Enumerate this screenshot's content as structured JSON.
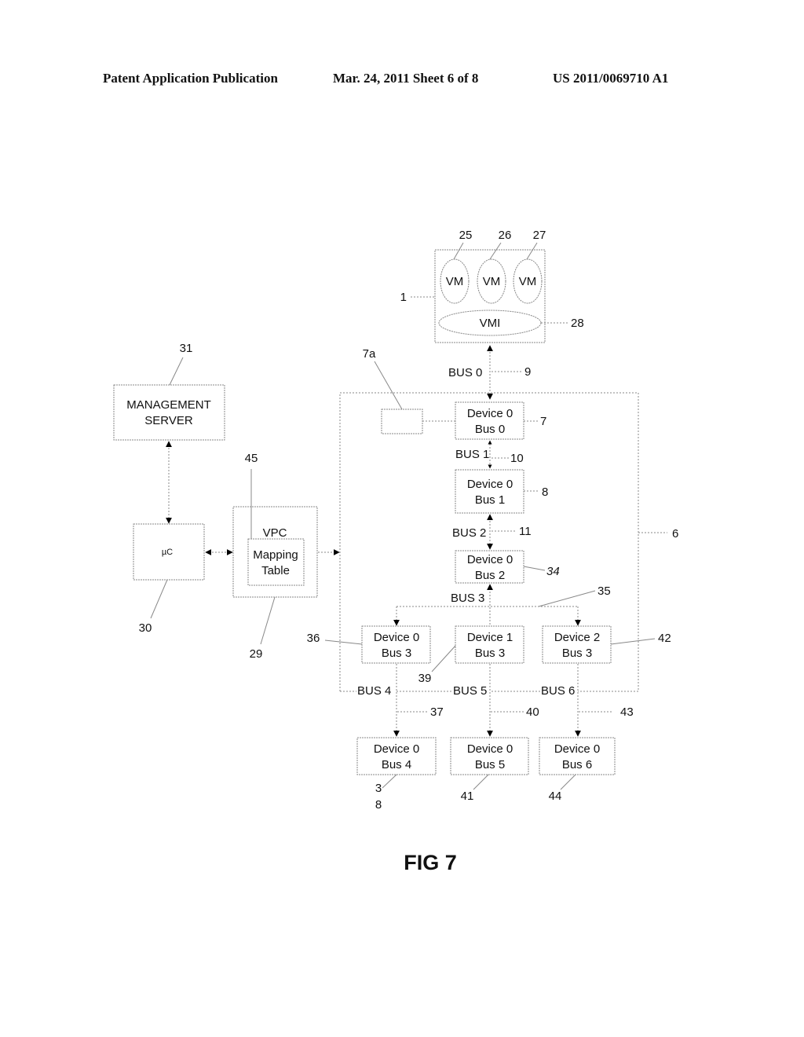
{
  "header": {
    "publication": "Patent Application Publication",
    "date_sheet": "Mar. 24, 2011  Sheet 6 of 8",
    "patent_number": "US 2011/0069710 A1"
  },
  "figure": {
    "caption": "FIG 7",
    "host": {
      "ref": "1",
      "vms": [
        {
          "label": "VM",
          "ref": "25"
        },
        {
          "label": "VM",
          "ref": "26"
        },
        {
          "label": "VM",
          "ref": "27"
        }
      ],
      "vmi": {
        "label": "VMI",
        "ref": "28"
      }
    },
    "management_server": {
      "line1": "MANAGEMENT",
      "line2": "SERVER",
      "ref": "31"
    },
    "microcontroller": {
      "label": "µC",
      "ref": "30"
    },
    "vpc": {
      "label": "VPC",
      "ref": "29",
      "mapping_table": {
        "line1": "Mapping",
        "line2": "Table",
        "ref": "45"
      }
    },
    "switch": {
      "ref": "6",
      "port_box_ref": "7a"
    },
    "buses": {
      "bus0": {
        "label": "BUS 0",
        "ref": "9"
      },
      "bus1": {
        "label": "BUS 1",
        "ref": "10"
      },
      "bus2": {
        "label": "BUS 2",
        "ref": "11"
      },
      "bus3": {
        "label": "BUS 3",
        "ref": "35"
      },
      "bus4": {
        "label": "BUS 4",
        "ref": "37"
      },
      "bus5": {
        "label": "BUS 5",
        "ref": "40"
      },
      "bus6": {
        "label": "BUS 6",
        "ref": "43"
      }
    },
    "devices": {
      "d0b0": {
        "line1": "Device 0",
        "line2": "Bus 0",
        "ref": "7"
      },
      "d0b1": {
        "line1": "Device 0",
        "line2": "Bus 1",
        "ref": "8"
      },
      "d0b2": {
        "line1": "Device 0",
        "line2": "Bus 2",
        "ref": "34"
      },
      "d0b3": {
        "line1": "Device 0",
        "line2": "Bus 3",
        "ref": "36"
      },
      "d1b3": {
        "line1": "Device 1",
        "line2": "Bus 3",
        "ref": "39"
      },
      "d2b3": {
        "line1": "Device 2",
        "line2": "Bus 3",
        "ref": "42"
      },
      "d0b4": {
        "line1": "Device 0",
        "line2": "Bus 4",
        "ref_line1": "3",
        "ref_line2": "8"
      },
      "d0b5": {
        "line1": "Device 0",
        "line2": "Bus 5",
        "ref": "41"
      },
      "d0b6": {
        "line1": "Device 0",
        "line2": "Bus 6",
        "ref": "44"
      }
    }
  }
}
